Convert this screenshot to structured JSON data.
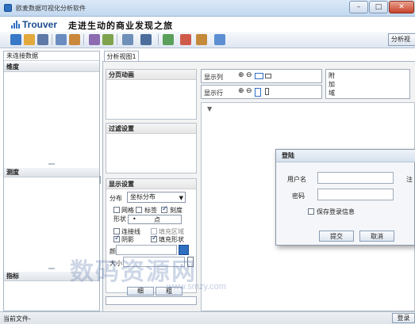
{
  "window": {
    "title": "欧麦数据可视化分析软件",
    "min": "–",
    "max": "□",
    "close": "✕"
  },
  "banner": {
    "logo": "Trouver",
    "slogan": "走进生动的商业发现之旅"
  },
  "toolbar": {
    "analysis_view_label": "分析视"
  },
  "left_panel": {
    "header": "未连接数据",
    "sections": [
      "维度",
      "测度",
      "指标"
    ]
  },
  "tabs": [
    {
      "label": "分析视图1"
    }
  ],
  "config": {
    "page_animation": "分页动画",
    "filter_settings": "过滤设置",
    "display_settings": "显示设置",
    "distribution_label": "分布",
    "distribution_value": "坐标分布",
    "grid": "网格",
    "labels": "标签",
    "scale": "刻度",
    "shape_label": "形状",
    "shape_value": "点",
    "connect_line": "连接线",
    "fill_region": "填充区域",
    "shadow": "阴影",
    "fill_shape": "填充形状",
    "color_label": "颜色",
    "size_label": "大小",
    "bottom_btn1": "细",
    "bottom_btn2": "粗"
  },
  "shelves": {
    "columns": "显示列",
    "rows": "显示行",
    "extra": "附加域"
  },
  "dialog": {
    "title": "登陆",
    "username_label": "用户名",
    "password_label": "密码",
    "remember": "保存登录信息",
    "submit": "提交",
    "cancel": "取消",
    "register_fragment": "注"
  },
  "status": {
    "text": "当前文件-",
    "login_button": "登录"
  },
  "watermark": {
    "main": "数码资源网",
    "sub": "www.smzy.com"
  },
  "colors": {
    "accent": "#2f6fc0",
    "titlebar": "#c2d8ef",
    "panel_bg": "#f3f3f3"
  }
}
